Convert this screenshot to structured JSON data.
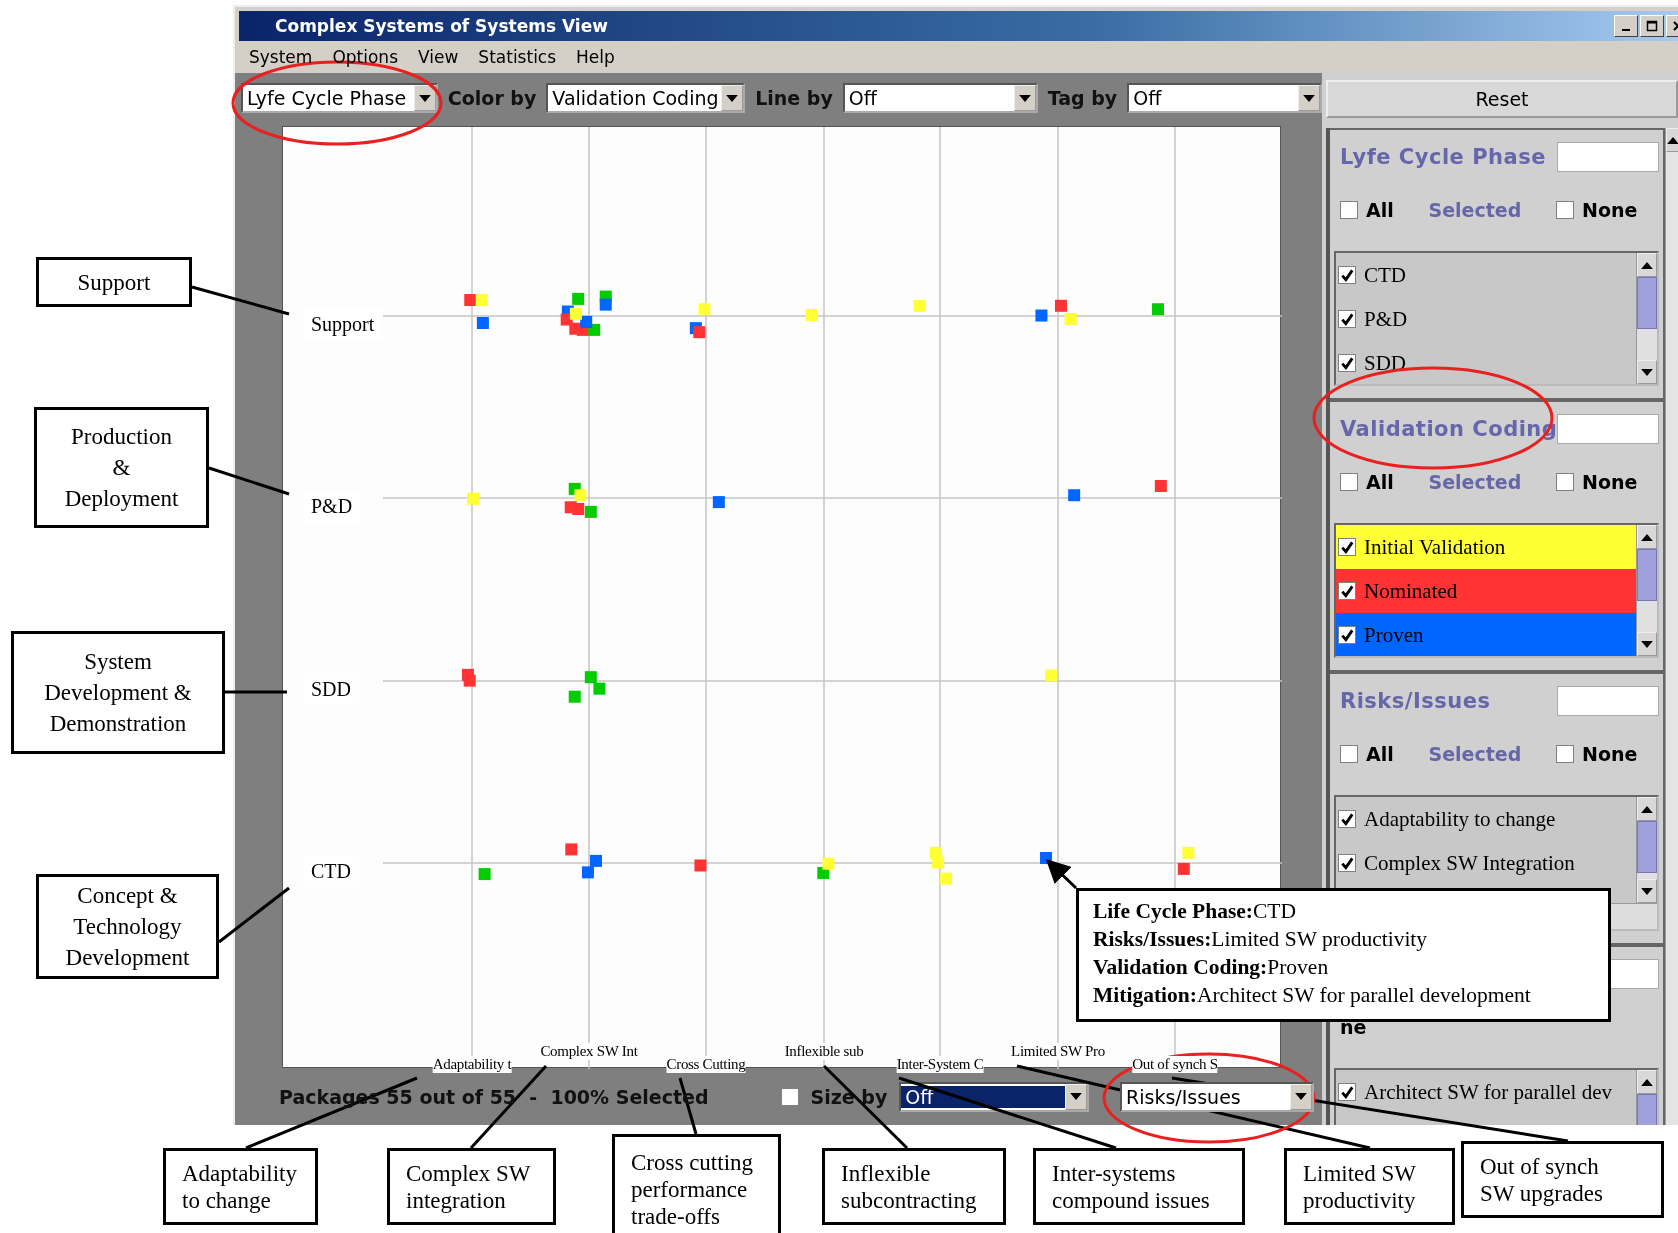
{
  "window": {
    "title": "Complex Systems of Systems View"
  },
  "menu": [
    "System",
    "Options",
    "View",
    "Statistics",
    "Help"
  ],
  "toolbar": [
    {
      "value": "Lyfe Cycle Phase"
    },
    {
      "label": "Color by",
      "value": "Validation Coding"
    },
    {
      "label": "Line by",
      "value": "Off"
    },
    {
      "label": "Tag by",
      "value": "Off"
    }
  ],
  "plot": {
    "rows": [
      "Support",
      "P&D",
      "SDD",
      "CTD"
    ],
    "columns": [
      "Adaptability t",
      "Complex SW Int",
      "Cross Cutting",
      "Inflexible sub",
      "Inter-System C",
      "Limited SW Pro",
      "Out of synch S"
    ]
  },
  "status": {
    "text": "Packages 55 out of 55  -  100% Selected",
    "checked": false,
    "size_by_label": "Size by",
    "size_by_value": "Off",
    "size_by_highlighted": true,
    "risk_dropdown": "Risks/Issues"
  },
  "panel": {
    "reset": "Reset",
    "sections": [
      {
        "title": "Lyfe Cycle Phase",
        "all": "All",
        "all_checked": false,
        "selected": "Selected",
        "none": "None",
        "none_checked": false,
        "items": [
          {
            "label": "CTD",
            "checked": true
          },
          {
            "label": "P&D",
            "checked": true
          },
          {
            "label": "SDD",
            "checked": true
          }
        ]
      },
      {
        "title": "Validation Coding",
        "all": "All",
        "all_checked": false,
        "selected": "Selected",
        "none": "None",
        "none_checked": false,
        "items": [
          {
            "label": "Initial Validation",
            "checked": true,
            "color": "#ffff33"
          },
          {
            "label": "Nominated",
            "checked": true,
            "color": "#ff3333"
          },
          {
            "label": "Proven",
            "checked": true,
            "color": "#0066ff"
          }
        ]
      },
      {
        "title": "Risks/Issues",
        "all": "All",
        "all_checked": false,
        "selected": "Selected",
        "none": "None",
        "none_checked": false,
        "items": [
          {
            "label": "Adaptability to change",
            "checked": true
          },
          {
            "label": "Complex SW Integration",
            "checked": true
          }
        ]
      },
      {
        "none": "ne",
        "items": [
          {
            "label": "Architect SW for parallel dev",
            "checked": true
          }
        ]
      }
    ]
  },
  "tooltip": [
    "**Life Cycle Phase:**CTD",
    "**Risks/Issues:**Limited SW productivity",
    "**Validation Coding:**Proven",
    "**Mitigation:**Architect SW for parallel development"
  ],
  "annotations": {
    "left": [
      "Support",
      "Production\n&\nDeployment",
      "System\nDevelopment &\nDemonstration",
      "Concept &\nTechnology\nDevelopment"
    ],
    "bottom": [
      "Adaptability\nto change",
      "Complex SW\nintegration",
      "Cross cutting\nperformance\ntrade-offs",
      "Inflexible\nsubcontracting",
      "Inter-systems\ncompound issues",
      "Limited SW\nproductivity",
      "Out of synch\nSW upgrades"
    ]
  }
}
